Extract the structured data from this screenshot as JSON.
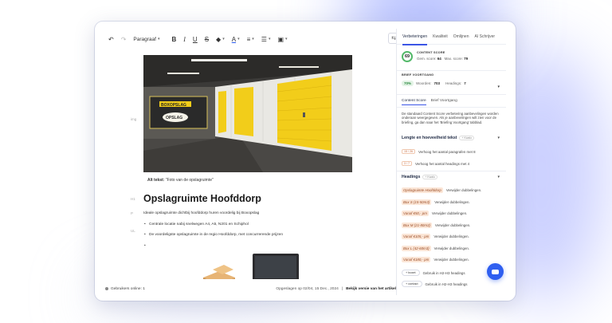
{
  "toolbar": {
    "undo": "↶",
    "redo": "↷",
    "paragraph": "Paragraaf",
    "bold": "B",
    "italic": "I",
    "underline": "U",
    "strike": "S",
    "fill": "◆",
    "text_color": "A",
    "align": "≡",
    "list": "☰",
    "image": "▣",
    "caret": "▾",
    "side_toggle": "⇆"
  },
  "editor": {
    "img_label": "img",
    "alt_prefix": "Alt tekst:",
    "alt_value": "\"Foto van de opslagruimte\"",
    "h1_tag": "H1",
    "heading": "Opslagruimte Hoofddorp",
    "p_tag": "P",
    "paragraph": "Ideale opslagruimte dichtbij hoofddorp huren voordelig bij Boxopslag",
    "ul_tag": "UL",
    "list": [
      "Centrale locatie nabij snelwegen A4, A5, N201 en Schiphol",
      "De voordeligste opslagruimte in de regio Hoofddorp, met concurrerende prijzen",
      ""
    ],
    "sign_text_1": "BOXOPSLAG",
    "sign_text_2": "OPSLAG"
  },
  "status": {
    "users_online": "Gebruikers online: 1",
    "saved": "Opgeslagen op 02/04, 15 Dec., 2024",
    "separator": "|",
    "view_link": "Bekijk versie van het artikel"
  },
  "panel": {
    "tabs": [
      "Verbeteringen",
      "Kwaliteit",
      "Omlijnen",
      "AI Schrijver"
    ],
    "score": {
      "value": "69",
      "title": "CONTENT SCORE",
      "avg_label": "Gem. score:",
      "avg": "64",
      "max_label": "Max. score:",
      "max": "79"
    },
    "progress": {
      "title": "BRIEF VOORTGANG",
      "percent": "70%",
      "words_label": "Woorden:",
      "words": "703",
      "headings_label": "Headings:",
      "headings": "7"
    },
    "subtabs": [
      "Content Score",
      "Brief Voortgang"
    ],
    "description": "De standaard Content Score verbetering aanbevelingen worden onderaan weergegeven. Als je aanbevelingen wilt zien voor de briefing, ga dan naar het 'Briefing Voortgang' tabblad.",
    "length": {
      "title": "Lengte en hoeveelheid tekst",
      "badge": "+ Kwalo",
      "items": [
        {
          "range": "15 / 26",
          "text": "Verhoog het aantal paragrafen met 8"
        },
        {
          "range": "3 / 7",
          "text": "Verhoog het aantal headings met 4"
        }
      ]
    },
    "headings": {
      "title": "Headings",
      "badge": "+ Kwalo",
      "items": [
        {
          "kw": "Opslagruimte Hoofddorp",
          "text": "Verwijder dubbelingen."
        },
        {
          "kw": "Box S (15-50m3)",
          "text": "Verwijder dubbelingen."
        },
        {
          "kw": "Vanaf €50,- pm",
          "text": "Verwijder dubbelingen."
        },
        {
          "kw": "Box M (21-80m3)",
          "text": "Verwijder dubbelingen."
        },
        {
          "kw": "Vanaf €105,- pm",
          "text": "Verwijder dubbelingen."
        },
        {
          "kw": "Box L (42-60m3)",
          "text": "Verwijder dubbelingen."
        },
        {
          "kw": "Vanaf €180,- pm",
          "text": "Verwijder dubbelingen."
        }
      ],
      "actions": [
        {
          "btn": "+ boxet",
          "text": "Gebruik in H2-H3 headings"
        },
        {
          "btn": "+ contact",
          "text": "Gebruik in H2-H3 headings"
        }
      ]
    }
  },
  "colors": {
    "accent": "#3b55e6",
    "score_green": "#54b96a",
    "chat_button": "#2f5ff0",
    "door_yellow": "#f2cd1a"
  }
}
